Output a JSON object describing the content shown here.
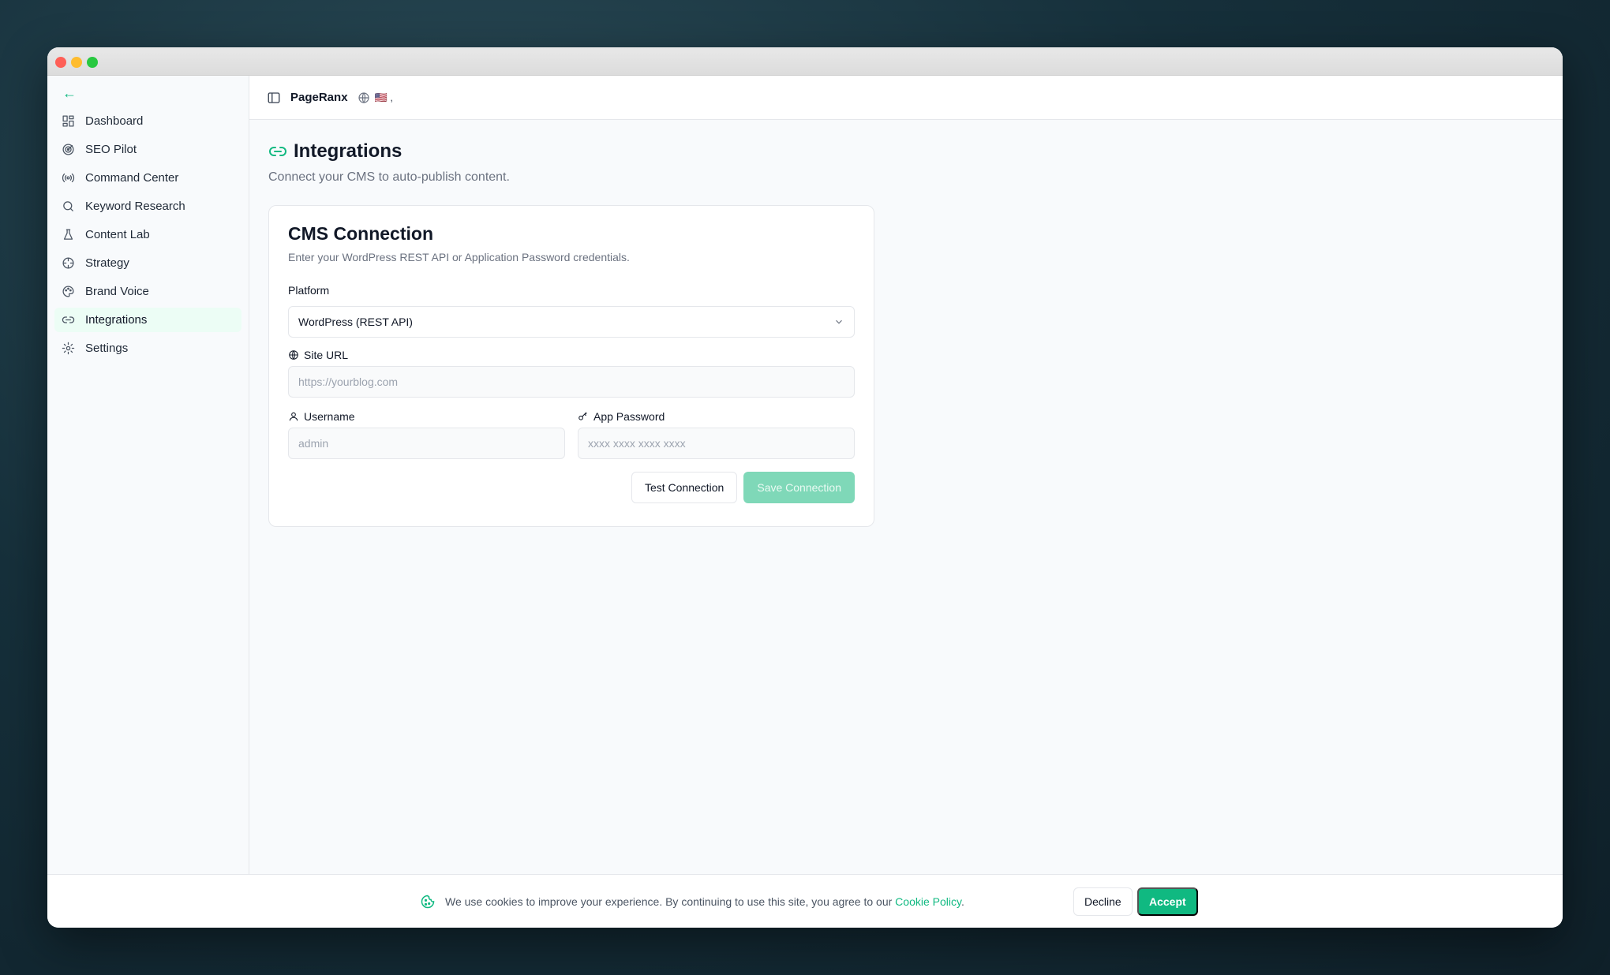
{
  "sidebar": {
    "back_icon": "arrow-left-icon",
    "items": [
      {
        "label": "Dashboard",
        "icon": "grid-icon"
      },
      {
        "label": "SEO Pilot",
        "icon": "radar-icon"
      },
      {
        "label": "Command Center",
        "icon": "radio-icon"
      },
      {
        "label": "Keyword Research",
        "icon": "search-icon"
      },
      {
        "label": "Content Lab",
        "icon": "flask-icon"
      },
      {
        "label": "Strategy",
        "icon": "crosshair-icon"
      },
      {
        "label": "Brand Voice",
        "icon": "palette-icon"
      },
      {
        "label": "Integrations",
        "icon": "link-icon",
        "active": true
      },
      {
        "label": "Settings",
        "icon": "gear-icon"
      }
    ]
  },
  "topbar": {
    "brand": "PageRanx",
    "flag": "🇺🇸 ,"
  },
  "page": {
    "title": "Integrations",
    "subtitle": "Connect your CMS to auto-publish content."
  },
  "card": {
    "title": "CMS Connection",
    "description": "Enter your WordPress REST API or Application Password credentials.",
    "platform_label": "Platform",
    "platform_value": "WordPress (REST API)",
    "site_url_label": "Site URL",
    "site_url_placeholder": "https://yourblog.com",
    "username_label": "Username",
    "username_placeholder": "admin",
    "password_label": "App Password",
    "password_placeholder": "xxxx xxxx xxxx xxxx",
    "test_button": "Test Connection",
    "save_button": "Save Connection"
  },
  "cookie": {
    "text": "We use cookies to improve your experience. By continuing to use this site, you agree to our ",
    "link": "Cookie Policy",
    "suffix": ".",
    "decline": "Decline",
    "accept": "Accept"
  },
  "colors": {
    "accent": "#10b981",
    "accent_disabled": "#7fd8b8"
  }
}
